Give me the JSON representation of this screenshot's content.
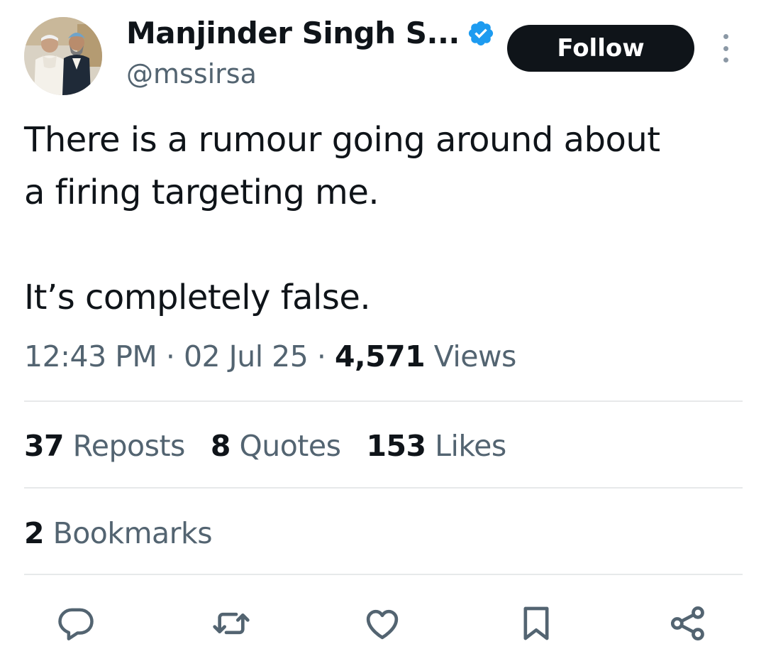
{
  "author": {
    "name": "Manjinder Singh S...",
    "handle": "@mssirsa",
    "verified": true
  },
  "header": {
    "follow_label": "Follow"
  },
  "tweet": {
    "line1": "There is a rumour going around about",
    "line2": "a firing targeting me.",
    "line3": "It’s completely false."
  },
  "meta": {
    "time": "12:43 PM",
    "separator": "·",
    "date": "02 Jul 25",
    "views_count": "4,571",
    "views_label": "Views"
  },
  "stats": {
    "reposts_count": "37",
    "reposts_label": "Reposts",
    "quotes_count": "8",
    "quotes_label": "Quotes",
    "likes_count": "153",
    "likes_label": "Likes",
    "bookmarks_count": "2",
    "bookmarks_label": "Bookmarks"
  },
  "actions": [
    "reply-icon",
    "repost-icon",
    "like-icon",
    "bookmark-icon",
    "share-icon"
  ],
  "colors": {
    "text": "#0f1419",
    "secondary": "#536471",
    "verified": "#1d9bf0",
    "divider": "#e7e9ea",
    "button": "#0f1419"
  }
}
